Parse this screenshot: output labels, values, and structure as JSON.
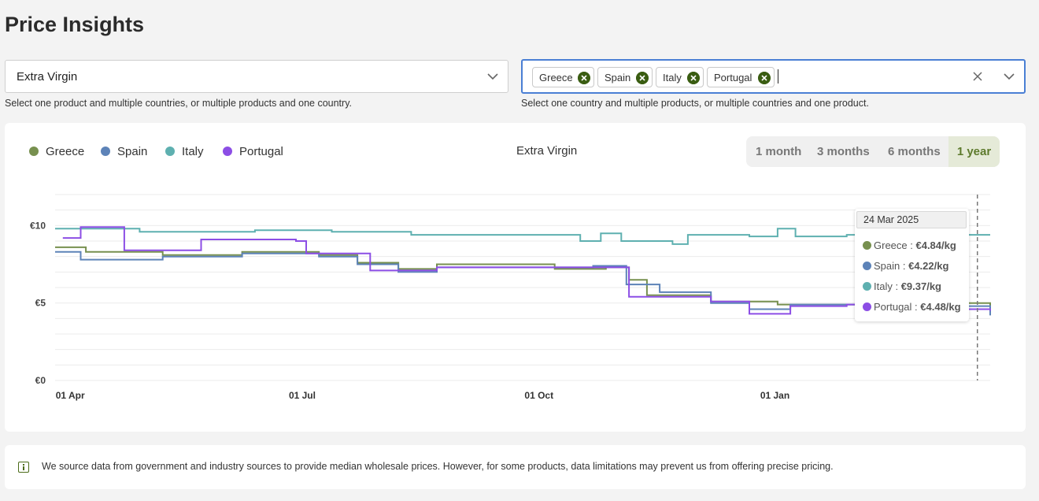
{
  "page": {
    "title": "Price Insights"
  },
  "product_select": {
    "value": "Extra Virgin",
    "helper": "Select one product and multiple countries, or multiple products and one country."
  },
  "country_select": {
    "chips": [
      "Greece",
      "Spain",
      "Italy",
      "Portugal"
    ],
    "helper": "Select one country and multiple products, or multiple countries and one product."
  },
  "legend": [
    {
      "name": "Greece",
      "color": "#77904f"
    },
    {
      "name": "Spain",
      "color": "#5d83b8"
    },
    {
      "name": "Italy",
      "color": "#5eb0b0"
    },
    {
      "name": "Portugal",
      "color": "#8c4ee5"
    }
  ],
  "ranges": [
    "1 month",
    "3 months",
    "6 months",
    "1 year"
  ],
  "active_range": "1 year",
  "tooltip": {
    "date": "24 Mar 2025",
    "rows": [
      {
        "country": "Greece",
        "value": "€4.84/kg"
      },
      {
        "country": "Spain",
        "value": "€4.22/kg"
      },
      {
        "country": "Italy",
        "value": "€9.37/kg"
      },
      {
        "country": "Portugal",
        "value": "€4.48/kg"
      }
    ]
  },
  "chart_data": {
    "type": "line",
    "title": "Extra Virgin",
    "x_ticks": [
      "01 Apr",
      "01 Jul",
      "01 Oct",
      "01 Jan"
    ],
    "y_ticks": [
      "€0",
      "€5",
      "€10"
    ],
    "ylim": [
      0,
      12
    ],
    "xlim": [
      "2024-03-29",
      "2025-03-29"
    ],
    "grid": true,
    "legend_position": "top-left",
    "series": [
      {
        "name": "Greece",
        "points": [
          [
            "2024-03-29",
            8.6
          ],
          [
            "2024-04-10",
            8.3
          ],
          [
            "2024-05-10",
            8.1
          ],
          [
            "2024-06-10",
            8.3
          ],
          [
            "2024-07-10",
            8.1
          ],
          [
            "2024-07-25",
            7.6
          ],
          [
            "2024-08-10",
            7.2
          ],
          [
            "2024-08-25",
            7.5
          ],
          [
            "2024-09-20",
            7.5
          ],
          [
            "2024-10-10",
            7.2
          ],
          [
            "2024-10-30",
            7.3
          ],
          [
            "2024-11-08",
            6.5
          ],
          [
            "2024-11-15",
            5.5
          ],
          [
            "2024-12-10",
            5.1
          ],
          [
            "2025-01-05",
            4.9
          ],
          [
            "2025-02-05",
            5.0
          ],
          [
            "2025-03-29",
            4.8
          ]
        ]
      },
      {
        "name": "Spain",
        "points": [
          [
            "2024-03-29",
            8.3
          ],
          [
            "2024-04-08",
            7.8
          ],
          [
            "2024-05-10",
            8.0
          ],
          [
            "2024-06-10",
            8.2
          ],
          [
            "2024-07-10",
            8.0
          ],
          [
            "2024-07-25",
            7.5
          ],
          [
            "2024-08-10",
            7.0
          ],
          [
            "2024-08-25",
            7.3
          ],
          [
            "2024-09-20",
            7.3
          ],
          [
            "2024-10-25",
            7.4
          ],
          [
            "2024-11-07",
            6.2
          ],
          [
            "2024-11-20",
            5.7
          ],
          [
            "2024-12-10",
            5.0
          ],
          [
            "2024-12-25",
            4.6
          ],
          [
            "2025-01-10",
            4.9
          ],
          [
            "2025-02-10",
            4.8
          ],
          [
            "2025-03-29",
            4.2
          ]
        ]
      },
      {
        "name": "Italy",
        "points": [
          [
            "2024-03-29",
            9.8
          ],
          [
            "2024-05-01",
            9.6
          ],
          [
            "2024-06-15",
            9.7
          ],
          [
            "2024-07-15",
            9.6
          ],
          [
            "2024-08-15",
            9.4
          ],
          [
            "2024-09-30",
            9.4
          ],
          [
            "2024-10-20",
            9.0
          ],
          [
            "2024-10-28",
            9.5
          ],
          [
            "2024-11-05",
            9.0
          ],
          [
            "2024-11-25",
            8.8
          ],
          [
            "2024-12-01",
            9.4
          ],
          [
            "2024-12-25",
            9.3
          ],
          [
            "2025-01-05",
            9.8
          ],
          [
            "2025-01-12",
            9.3
          ],
          [
            "2025-02-01",
            9.4
          ],
          [
            "2025-03-29",
            9.4
          ]
        ]
      },
      {
        "name": "Portugal",
        "points": [
          [
            "2024-04-01",
            9.2
          ],
          [
            "2024-04-08",
            9.9
          ],
          [
            "2024-04-25",
            8.4
          ],
          [
            "2024-05-25",
            9.1
          ],
          [
            "2024-07-01",
            9.0
          ],
          [
            "2024-07-05",
            8.2
          ],
          [
            "2024-07-30",
            7.1
          ],
          [
            "2024-08-25",
            7.3
          ],
          [
            "2024-09-20",
            7.3
          ],
          [
            "2024-10-30",
            7.3
          ],
          [
            "2024-11-08",
            5.4
          ],
          [
            "2024-12-10",
            5.1
          ],
          [
            "2024-12-25",
            4.3
          ],
          [
            "2025-01-10",
            4.8
          ],
          [
            "2025-02-01",
            4.9
          ],
          [
            "2025-02-25",
            4.6
          ],
          [
            "2025-03-29",
            4.5
          ]
        ]
      }
    ]
  },
  "info": {
    "text": "We source data from government and industry sources to provide median wholesale prices. However, for some products, data limitations may prevent us from offering precise pricing."
  }
}
